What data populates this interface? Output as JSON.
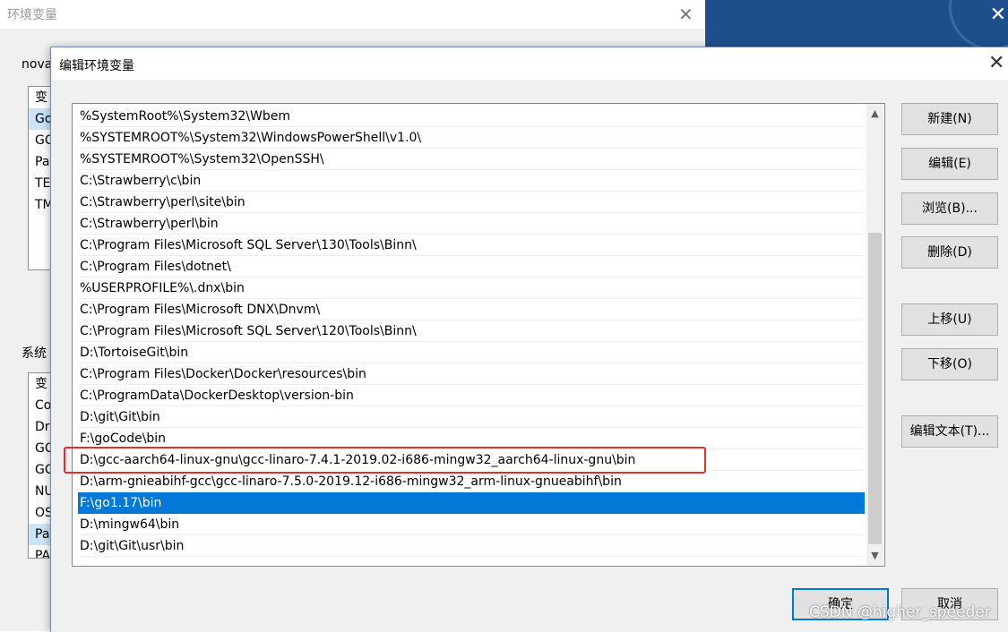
{
  "parent_window": {
    "title": "环境变量",
    "user_section_label": "nova",
    "system_section_label": "系统",
    "user_vars_preview": [
      "变",
      "Go",
      "GC",
      "Pa",
      "TE",
      "TM"
    ],
    "system_vars_preview": [
      "变",
      "Co",
      "Dr",
      "GC",
      "GC",
      "NU",
      "OS",
      "Pa",
      "PA"
    ]
  },
  "dialog": {
    "title": "编辑环境变量",
    "path_entries": [
      "%SystemRoot%\\System32\\Wbem",
      "%SYSTEMROOT%\\System32\\WindowsPowerShell\\v1.0\\",
      "%SYSTEMROOT%\\System32\\OpenSSH\\",
      "C:\\Strawberry\\c\\bin",
      "C:\\Strawberry\\perl\\site\\bin",
      "C:\\Strawberry\\perl\\bin",
      "C:\\Program Files\\Microsoft SQL Server\\130\\Tools\\Binn\\",
      "C:\\Program Files\\dotnet\\",
      "%USERPROFILE%\\.dnx\\bin",
      "C:\\Program Files\\Microsoft DNX\\Dnvm\\",
      "C:\\Program Files\\Microsoft SQL Server\\120\\Tools\\Binn\\",
      "D:\\TortoiseGit\\bin",
      "C:\\Program Files\\Docker\\Docker\\resources\\bin",
      "C:\\ProgramData\\DockerDesktop\\version-bin",
      "D:\\git\\Git\\bin",
      "F:\\goCode\\bin",
      "D:\\gcc-aarch64-linux-gnu\\gcc-linaro-7.4.1-2019.02-i686-mingw32_aarch64-linux-gnu\\bin",
      "D:\\arm-gnieabihf-gcc\\gcc-linaro-7.5.0-2019.12-i686-mingw32_arm-linux-gnueabihf\\bin",
      "F:\\go1.17\\bin",
      "D:\\mingw64\\bin",
      "D:\\git\\Git\\usr\\bin"
    ],
    "selected_index": 18,
    "highlighted_index": 16,
    "buttons": {
      "new": "新建(N)",
      "edit": "编辑(E)",
      "browse": "浏览(B)...",
      "delete": "删除(D)",
      "move_up": "上移(U)",
      "move_down": "下移(O)",
      "edit_text": "编辑文本(T)...",
      "ok": "确定",
      "cancel": "取消"
    }
  },
  "watermark": "CSDN @higher_speeder",
  "colors": {
    "selection": "#0078d7",
    "highlight_border": "#e02f2f",
    "desktop": "#1e4f8c"
  }
}
